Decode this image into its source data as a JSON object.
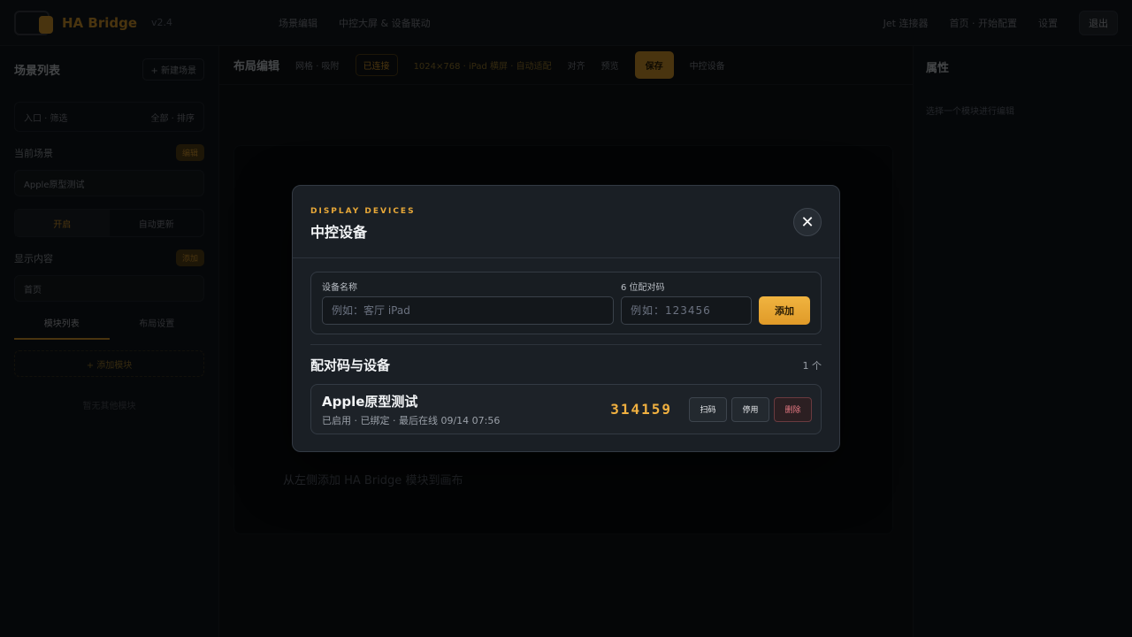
{
  "app": {
    "brand": "HA Bridge",
    "brand_sub": "v2.4",
    "nav": [
      "场景编辑",
      "中控大屏 &amp; 设备联动"
    ],
    "top_right": [
      "Jet 连接器",
      "首页 · 开始配置",
      "设置"
    ],
    "top_button": "退出"
  },
  "sidebar": {
    "title": "场景列表",
    "title_button": "+ 新建场景",
    "search": "入口 · 筛选",
    "search_right": "全部 · 排序",
    "group1_label": "当前场景",
    "group1_badge": "编辑",
    "group1_select": "Apple原型测试",
    "toggle": [
      "开启",
      "自动更新"
    ],
    "group2_label": "显示内容",
    "group2_badge": "添加",
    "group2_select": "首页",
    "tabs": [
      "模块列表",
      "布局设置"
    ],
    "add_button": "+ 添加模块",
    "footer": "暂无其他模块"
  },
  "main": {
    "title": "布局编辑",
    "toolbar_items": [
      "网格 · 吸附",
      "已连接",
      "1024×768 · iPad 横屏 · 自动适配",
      "对齐",
      "预览",
      "保存",
      "中控设备"
    ],
    "save_button": "保存",
    "hint": "从左侧添加 HA Bridge 模块到画布"
  },
  "rightpane": {
    "title": "属性",
    "note": "选择一个模块进行编辑"
  },
  "modal": {
    "eyebrow": "DISPLAY DEVICES",
    "title": "中控设备",
    "close_glyph": "✕",
    "form": {
      "name_label": "设备名称",
      "name_placeholder": "例如：客厅 iPad",
      "name_value": "",
      "code_label": "6 位配对码",
      "code_placeholder": "例如：123456",
      "code_value": "",
      "add_label": "添加"
    },
    "list": {
      "title": "配对码与设备",
      "count": "1 个",
      "devices": [
        {
          "name": "Apple原型测试",
          "meta": "已启用 · 已绑定 · 最后在线 09/14 07:56",
          "code": "314159",
          "actions": [
            "扫码",
            "停用",
            "删除"
          ]
        }
      ]
    }
  },
  "colors": {
    "accent": "#e8a838",
    "danger": "#e57882",
    "modal_bg": "#1a1f25"
  }
}
